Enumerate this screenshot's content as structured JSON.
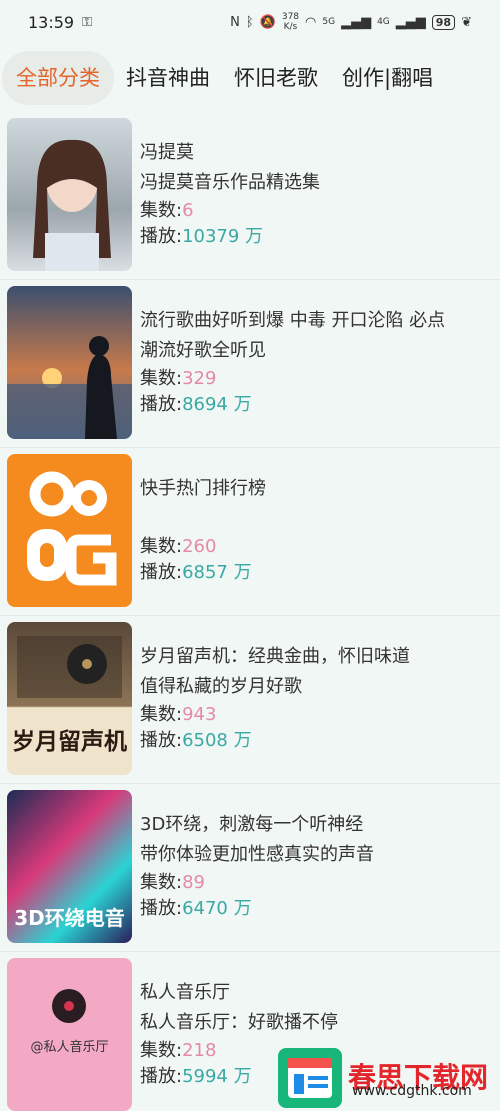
{
  "status": {
    "time": "13:59",
    "net_speed_top": "378",
    "net_speed_bottom": "K/s",
    "signal1": "5G",
    "signal2": "4G",
    "battery": "98"
  },
  "tabs": [
    {
      "label": "全部分类",
      "active": true
    },
    {
      "label": "抖音神曲"
    },
    {
      "label": "怀旧老歌"
    },
    {
      "label": "创作|翻唱"
    }
  ],
  "items": [
    {
      "title": "冯提莫",
      "subtitle": "冯提莫音乐作品精选集",
      "count_label": "集数:",
      "count": "6",
      "plays_label": "播放:",
      "plays": "10379 万"
    },
    {
      "title": "流行歌曲好听到爆 中毒 开口沦陷 必点",
      "subtitle": "潮流好歌全听见",
      "count_label": "集数:",
      "count": "329",
      "plays_label": "播放:",
      "plays": "8694 万"
    },
    {
      "title": "快手热门排行榜",
      "subtitle": "",
      "count_label": "集数:",
      "count": "260",
      "plays_label": "播放:",
      "plays": "6857 万"
    },
    {
      "title": "岁月留声机：经典金曲，怀旧味道",
      "subtitle": "值得私藏的岁月好歌",
      "count_label": "集数:",
      "count": "943",
      "plays_label": "播放:",
      "plays": "6508 万",
      "cover_text": "岁月留声机"
    },
    {
      "title": "3D环绕，刺激每一个听神经",
      "subtitle": "带你体验更加性感真实的声音",
      "count_label": "集数:",
      "count": "89",
      "plays_label": "播放:",
      "plays": "6470 万",
      "cover_text": "3D环绕电音"
    },
    {
      "title": "私人音乐厅",
      "subtitle": "私人音乐厅：好歌播不停",
      "count_label": "集数:",
      "count": "218",
      "plays_label": "播放:",
      "plays": "5994 万",
      "cover_text": "@私人音乐厅"
    }
  ],
  "watermark": {
    "name": "春思下载网",
    "url": "www.cdgthk.com"
  }
}
